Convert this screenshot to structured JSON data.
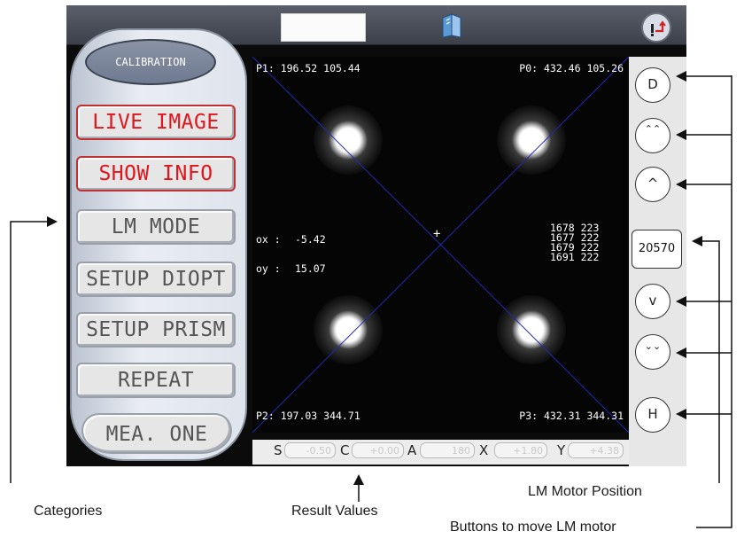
{
  "calibration_label": "CALIBRATION",
  "categories": [
    {
      "label": "LIVE IMAGE",
      "active": true
    },
    {
      "label": "SHOW INFO",
      "active": true
    },
    {
      "label": "LM MODE",
      "active": false
    },
    {
      "label": "SETUP DIOPT",
      "active": false
    },
    {
      "label": "SETUP PRISM",
      "active": false
    },
    {
      "label": "REPEAT",
      "active": false
    },
    {
      "label": "MEA. ONE",
      "active": false
    }
  ],
  "image": {
    "p1": "P1: 196.52 105.44",
    "p0": "P0: 432.46 105.26",
    "p2": "P2: 197.03 344.71",
    "p3": "P3: 432.31 344.31",
    "ox_label": "ox :",
    "ox_value": "-5.42",
    "oy_label": "oy :",
    "oy_value": "15.07",
    "info_lines": [
      "1678 223",
      "1677 222",
      "1679 222",
      "1691 222"
    ],
    "crosshair": "+"
  },
  "results": [
    {
      "label": "S",
      "value": "-0.50"
    },
    {
      "label": "C",
      "value": "+0.00"
    },
    {
      "label": "A",
      "value": "180"
    },
    {
      "label": "X",
      "value": "+1.80"
    },
    {
      "label": "Y",
      "value": "+4.38"
    }
  ],
  "motor_buttons": {
    "d": "D",
    "fast_up": "⌃⌃",
    "up": "^",
    "position": "20570",
    "down": "v",
    "fast_down": "⌄⌄",
    "h": "H"
  },
  "annotations": {
    "categories": "Categories",
    "result_values": "Result Values",
    "lm_motor_position": "LM Motor Position",
    "buttons_move": "Buttons to move LM motor"
  },
  "colors": {
    "active_red": "#e2141c",
    "inactive_gray": "#555555",
    "overlay_line": "#1f2bb0"
  },
  "icons": [
    "book-icon",
    "exit-icon",
    "arrow-icon"
  ]
}
